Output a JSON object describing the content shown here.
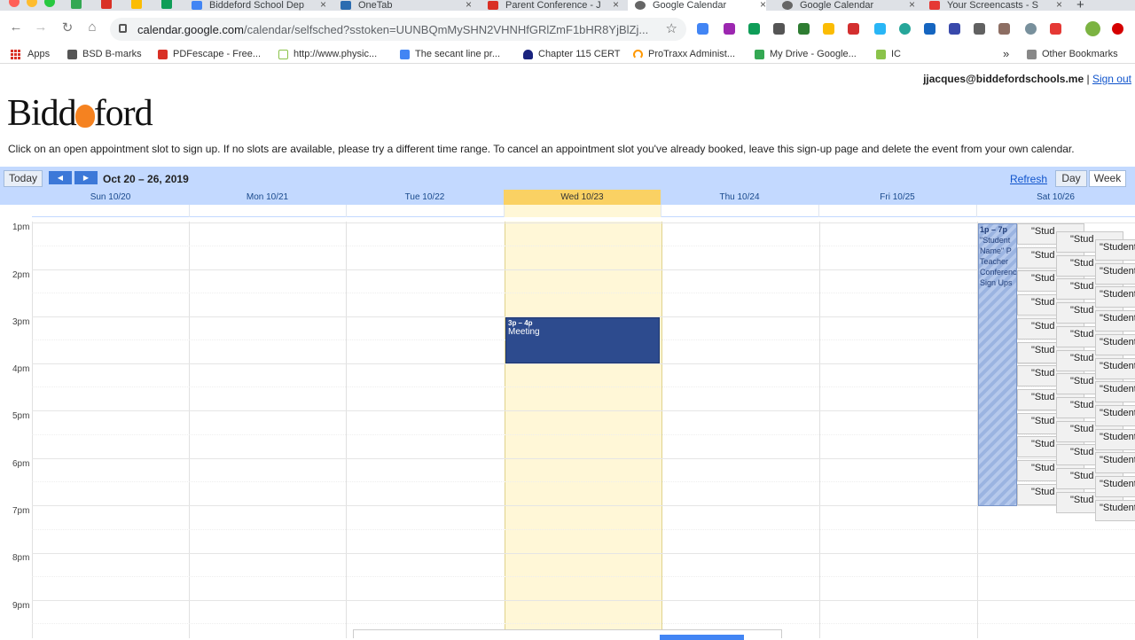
{
  "browser": {
    "tabs": [
      {
        "label": "Biddeford School Dep",
        "fav": "#4285f4"
      },
      {
        "label": "OneTab",
        "fav": "#2b6cb0"
      },
      {
        "label": "Parent Conference - J",
        "fav": "#d93025"
      },
      {
        "label": "Google Calendar",
        "fav": "#666666"
      },
      {
        "label": "Google Calendar",
        "fav": "#666666"
      },
      {
        "label": "Your Screencasts - S",
        "fav": "#e53935"
      }
    ],
    "new_tab": "+",
    "url_host": "calendar.google.com",
    "url_path": "/calendar/selfsched?sstoken=UUNBQmMySHN2VHNHfGRlZmF1bHR8YjBlZj...",
    "bookmarks": [
      {
        "label": "Apps"
      },
      {
        "label": "BSD B-marks",
        "color": "#555555"
      },
      {
        "label": "PDFescape - Free...",
        "color": "#d93025"
      },
      {
        "label": "http://www.physic...",
        "color": "#8bc34a"
      },
      {
        "label": "The secant line pr...",
        "color": "#4285f4"
      },
      {
        "label": "Chapter 115 CERT",
        "color": "#1a237e"
      },
      {
        "label": "ProTraxx Administ...",
        "color": "#ff9800"
      },
      {
        "label": "My Drive - Google...",
        "color": "#34a853"
      },
      {
        "label": "IC",
        "color": "#8bc34a"
      }
    ],
    "bookmarks_overflow": "»",
    "other_bookmarks": "Other Bookmarks"
  },
  "page": {
    "user_email": "jjacques@biddefordschools.me",
    "separator": "|",
    "sign_out": "Sign out",
    "logo_left": "Bidd",
    "logo_right": "ford",
    "instructions": "Click on an open appointment slot to sign up. If no slots are available, please try a different time range. To cancel an appointment slot you've already booked, leave this sign-up page and delete the event from your own calendar."
  },
  "calendar": {
    "today_label": "Today",
    "prev_label": "◀",
    "next_label": "▶",
    "date_range": "Oct 20 – 26, 2019",
    "refresh_label": "Refresh",
    "day_label": "Day",
    "week_label": "Week",
    "days": [
      "Sun 10/20",
      "Mon 10/21",
      "Tue 10/22",
      "Wed 10/23",
      "Thu 10/24",
      "Fri 10/25",
      "Sat 10/26"
    ],
    "today_index": 3,
    "hours": [
      "1pm",
      "2pm",
      "3pm",
      "4pm",
      "5pm",
      "6pm",
      "7pm",
      "8pm",
      "9pm"
    ],
    "meeting": {
      "time": "3p – 4p",
      "title": "Meeting"
    },
    "availability": {
      "time": "1p – 7p",
      "text": "\"Student Name\" P Teacher Conference Sign Ups"
    },
    "slot_label_short": "\"Stud",
    "slot_label_long": "\"Student"
  },
  "colors": {
    "accent": "#c3d9ff",
    "today": "#fad163",
    "meeting": "#2d4b8e"
  }
}
